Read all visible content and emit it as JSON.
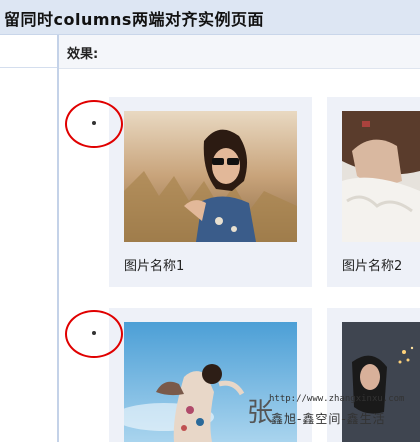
{
  "page": {
    "title": "留同时columns两端对齐实例页面",
    "effect_label": "效果:"
  },
  "cards": [
    {
      "caption": "图片名称1",
      "image": "photo-woman-sunglasses-wheat-field"
    },
    {
      "caption": "图片名称2",
      "image": "photo-woman-white-fur"
    },
    {
      "caption": "",
      "image": "photo-woman-blue-sky"
    },
    {
      "caption": "",
      "image": "photo-woman-fireworks"
    }
  ],
  "watermark": {
    "big_char": "张",
    "url": "http://www.zhangxinxu.com",
    "subtitle": "鑫旭-鑫空间-鑫生活"
  },
  "colors": {
    "title_bar": "#dde6f3",
    "card_bg": "#eef1f8",
    "annotation_circle": "#e00000"
  }
}
